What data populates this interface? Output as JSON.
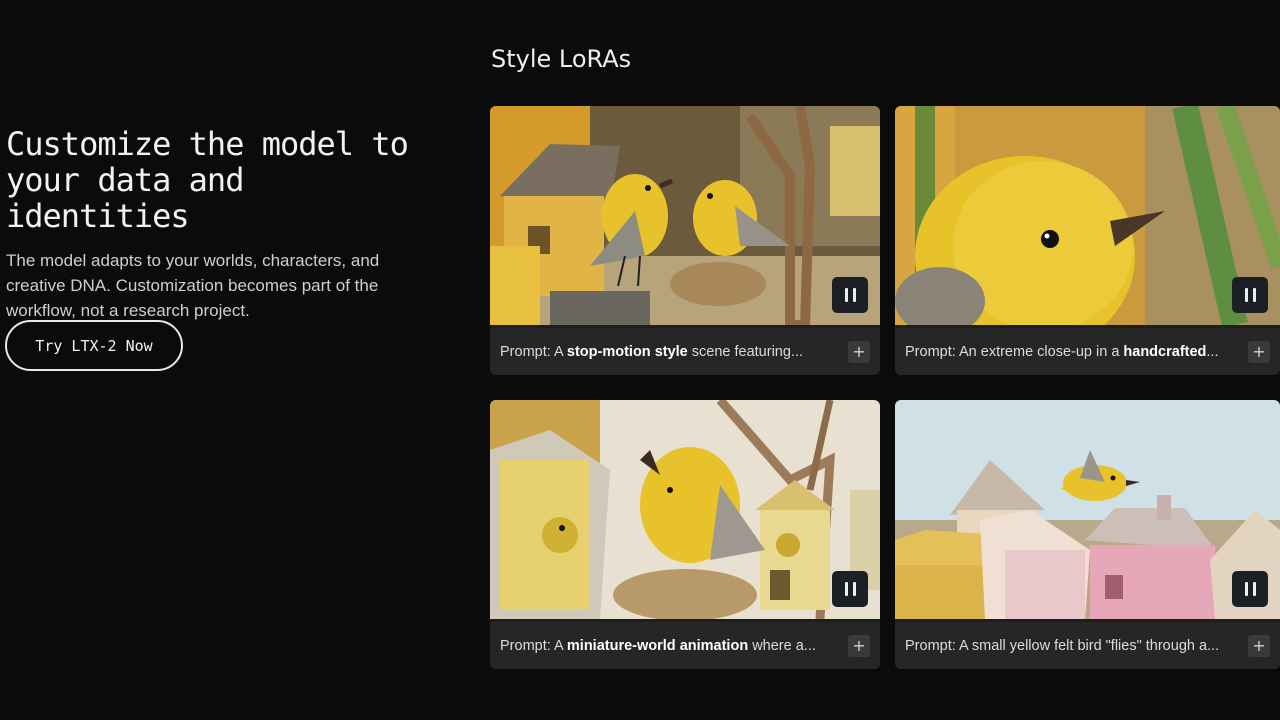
{
  "hero": {
    "title_line1": "Customize the model to",
    "title_line2": "your data and identities",
    "description": "The model adapts to your worlds, characters, and creative DNA. Customization becomes part of the workflow, not a research project.",
    "cta_label": "Try LTX-2 Now"
  },
  "section": {
    "title": "Style LoRAs"
  },
  "cards": [
    {
      "prefix": "Prompt: A ",
      "bold": "stop-motion style",
      "suffix": " scene featuring...",
      "plus": "+",
      "pause_icon": "pause-icon"
    },
    {
      "prefix": "Prompt: An extreme close-up in a ",
      "bold": "handcrafted",
      "suffix": "...",
      "plus": "+",
      "pause_icon": "pause-icon"
    },
    {
      "prefix": "Prompt: A ",
      "bold": "miniature-world animation",
      "suffix": " where a...",
      "plus": "+",
      "pause_icon": "pause-icon"
    },
    {
      "prefix": "Prompt: A small yellow felt bird \"flies\" through a...",
      "bold": "",
      "suffix": "",
      "plus": "+",
      "pause_icon": "pause-icon"
    }
  ],
  "colors": {
    "background": "#0b0b0b",
    "caption_bg": "#262626",
    "felt_yellow": "#e8c22a"
  }
}
